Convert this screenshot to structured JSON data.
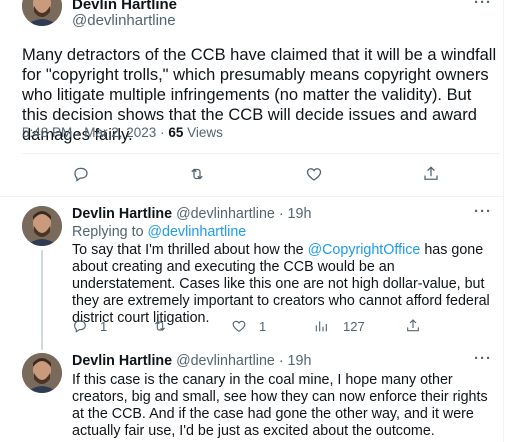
{
  "main_tweet": {
    "author_name": "Devlin Hartline",
    "handle": "@devlinhartline",
    "more_label": "···",
    "text": "Many detractors of the CCB have claimed that it will be a windfall for \"copyright trolls,\" which presumably means copyright owners who litigate multiple infringements (no matter the validity). But this decision shows that the CCB will decide issues and award damages fairly.",
    "time": "5:48 PM · Mar 2, 2023 · ",
    "views_count": "65",
    "views_label": " Views",
    "actions": [
      {
        "name": "reply",
        "icon": "reply-icon",
        "count": ""
      },
      {
        "name": "retweet",
        "icon": "retweet-icon",
        "count": ""
      },
      {
        "name": "like",
        "icon": "heart-icon",
        "count": ""
      },
      {
        "name": "share",
        "icon": "share-icon",
        "count": ""
      }
    ]
  },
  "replies": [
    {
      "author_name": "Devlin Hartline",
      "handle_time": "@devlinhartline · 19h",
      "more_label": "···",
      "replying_prefix": "Replying to ",
      "replying_to": "@devlinhartline",
      "text_before": "To say that I'm thrilled about how the ",
      "mention": "@CopyrightOffice",
      "text_after": " has gone about creating and executing the CCB would be an understatement. Cases like this one are not high dollar-value, but they are extremely important to creators who cannot afford federal district court litigation.",
      "actions": {
        "reply_count": "1",
        "retweet_count": "",
        "like_count": "1",
        "views_count": "127"
      }
    },
    {
      "author_name": "Devlin Hartline",
      "handle_time": "@devlinhartline · 19h",
      "more_label": "···",
      "text": "If this case is the canary in the coal mine, I hope many other creators, big and small, see how they can now enforce their rights at the CCB. And if the case had gone the other way, and it were actually fair use, I'd be just as excited about the outcome."
    }
  ],
  "colors": {
    "text": "#0f1419",
    "muted": "#536471",
    "accent": "#1d9bf0",
    "divider": "#eff3f4"
  }
}
